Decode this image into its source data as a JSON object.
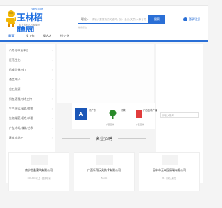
{
  "topbar": {
    "left": "",
    "right": ""
  },
  "logo": {
    "title": "玉林招聘网",
    "url": "YLZPW.COM",
    "slogan": "本土求职人才聚集地"
  },
  "search": {
    "type_label": "职位",
    "placeholder": "请输入要搜索的关键词，如：会计/文员/人事专员",
    "button_label": "搜索"
  },
  "login": {
    "label": "登录/注册"
  },
  "hotwords": "热搜职位：",
  "nav": {
    "items": [
      "首页",
      "找工作",
      "找人才",
      "找企业"
    ]
  },
  "categories": [
    "公务员/事业单位",
    "医药/生化",
    "机械/设备/技工",
    "通信/电子",
    "化工/能源",
    "销售/客服/技术支持",
    "生产/营运/采购/物流",
    "生物/制药/医疗/护理",
    "广告/市场/媒体/艺术",
    "建筑/房地产"
  ],
  "panel": {
    "field_label": "请输入账号"
  },
  "thumbs": [
    {
      "name": "好广东",
      "sub": ""
    },
    {
      "name": "好茶",
      "sub": "广西玉林..."
    },
    {
      "name": "广西玉林广播",
      "sub": "广西玉林"
    }
  ],
  "section": {
    "title": "名企招聘"
  },
  "cards": [
    {
      "name": "南宁世鑫建筑有限公司",
      "meta": "30K-60K以上 · 置顶月提"
    },
    {
      "name": "广西乐翔玩具技术有限公司",
      "meta": "5K-6K"
    },
    {
      "name": "玉林市玉州区康瑞有限公司",
      "meta": "8 · 月收入职位"
    }
  ],
  "colors": {
    "brand": "#2a6fd6",
    "bg": "#f4f4f4"
  }
}
